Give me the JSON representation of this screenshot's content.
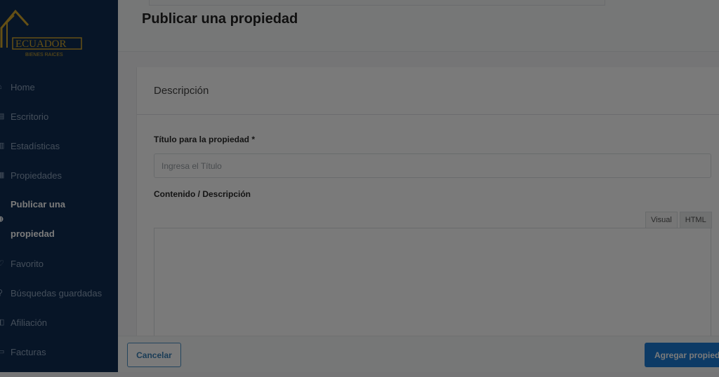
{
  "brand": {
    "logo_text": "ECUADOR",
    "logo_subtext": "BIENES RAICES",
    "accent_color": "#d4a72c"
  },
  "sidebar": {
    "items": [
      {
        "label": "Home",
        "icon": "home-icon"
      },
      {
        "label": "Escritorio",
        "icon": "dashboard-icon"
      },
      {
        "label": "Estadísticas",
        "icon": "stats-icon"
      },
      {
        "label": "Propiedades",
        "icon": "properties-icon"
      },
      {
        "label": "Publicar una propiedad",
        "line1": "Publicar una",
        "line2": "propiedad",
        "icon": "plus-circle-icon",
        "active": true
      },
      {
        "label": "Favorito",
        "icon": "heart-icon"
      },
      {
        "label": "Búsquedas guardadas",
        "icon": "search-icon"
      },
      {
        "label": "Afiliación",
        "icon": "membership-icon"
      },
      {
        "label": "Facturas",
        "icon": "invoice-icon"
      }
    ]
  },
  "header": {
    "title": "Publicar una propiedad"
  },
  "card": {
    "section_title": "Descripción",
    "title_field": {
      "label": "Título para la propiedad *",
      "value": "",
      "placeholder": "Ingresa el Título"
    },
    "content_field": {
      "label": "Contenido / Descripción",
      "tabs": [
        "Visual",
        "HTML"
      ],
      "active_tab": "Visual",
      "value": ""
    }
  },
  "footer": {
    "cancel_label": "Cancelar",
    "submit_label": "Agregar propiedad"
  },
  "colors": {
    "sidebar_bg": "#0f2d52",
    "primary_button": "#1c7cd6",
    "overlay": "rgba(0,0,0,0.52)"
  }
}
